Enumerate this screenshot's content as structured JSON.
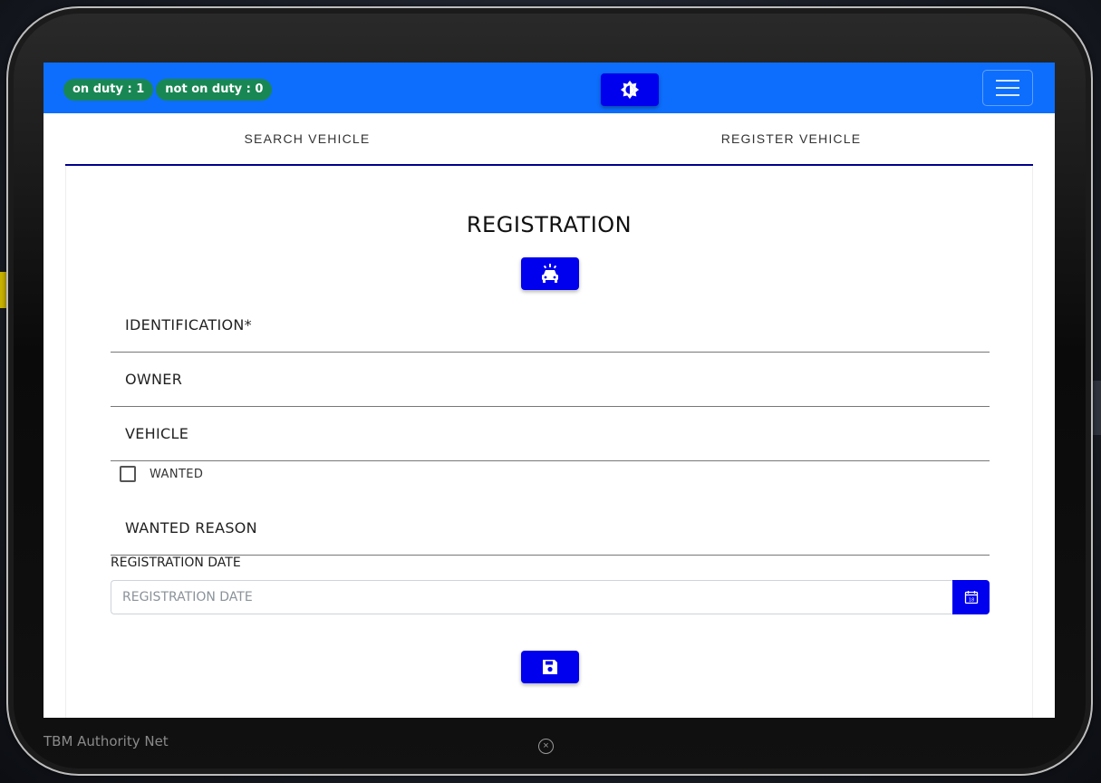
{
  "navbar": {
    "on_duty": "on duty : 1",
    "not_on_duty": "not on duty : 0",
    "theme_toggle_icon": "brightness-icon",
    "menu_icon": "hamburger-icon"
  },
  "tabs": [
    {
      "label": "SEARCH VEHICLE"
    },
    {
      "label": "REGISTER VEHICLE"
    }
  ],
  "form": {
    "title": "REGISTRATION",
    "header_icon": "police-car-icon",
    "fields": {
      "identification": "IDENTIFICATION*",
      "owner": "OWNER",
      "vehicle": "VEHICLE",
      "wanted_reason": "WANTED REASON"
    },
    "wanted_label": "WANTED",
    "wanted_checked": false,
    "date_label": "REGISTRATION DATE",
    "date_placeholder": "REGISTRATION DATE",
    "calendar_icon": "calendar-icon",
    "calendar_icon_text": "18",
    "save_icon": "save-icon"
  },
  "footer": {
    "brand": "TBM Authority Net",
    "close_icon": "close-circle-icon"
  },
  "colors": {
    "navbar": "#0d6efd",
    "badge": "#198754",
    "action_button": "#0000ee",
    "tab_underline": "#00008b"
  }
}
